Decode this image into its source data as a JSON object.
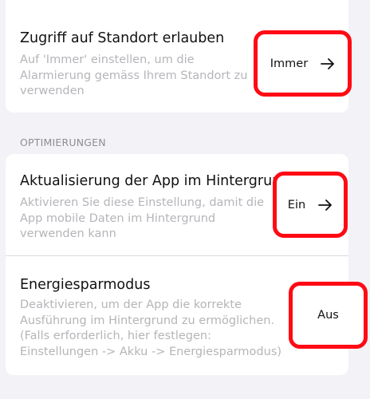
{
  "sections": {
    "location": {
      "title": "Zugriff auf Standort erlauben",
      "description": "Auf 'Immer' einstellen, um die\nAlarmierung gemäss Ihrem Standort zu\nverwenden",
      "value": "Immer",
      "icon": "arrow-right-icon"
    },
    "optimizations_header": "OPTIMIERUNGEN",
    "background_refresh": {
      "title": "Aktualisierung der App im Hintergrund",
      "description": "Aktivieren Sie diese Einstellung, damit die\nApp mobile Daten im Hintergrund\nverwenden kann",
      "value": "Ein",
      "icon": "arrow-right-icon"
    },
    "power_saving": {
      "title": "Energiesparmodus",
      "description": "Deaktivieren, um der App die korrekte\nAusführung im Hintergrund zu ermöglichen.\n(Falls erforderlich, hier festlegen:\nEinstellungen -> Akku -> Energiesparmodus)",
      "value": "Aus"
    }
  },
  "colors": {
    "highlight": "#ff0a14",
    "background": "#f2f2f7",
    "description_text": "#b5b5ba"
  }
}
